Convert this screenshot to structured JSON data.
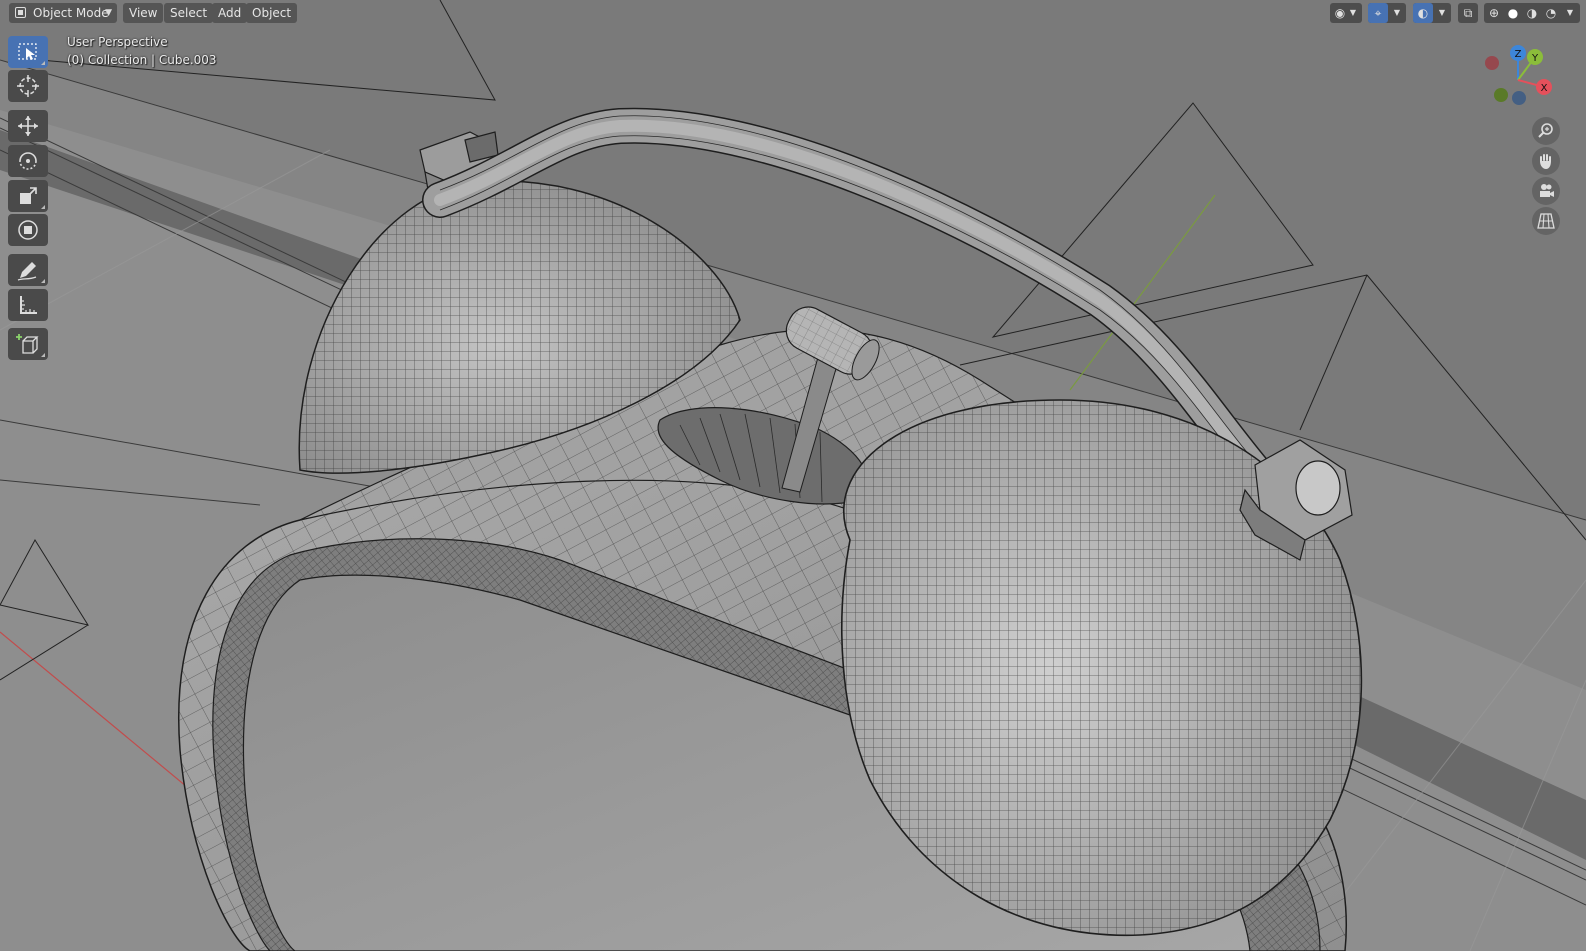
{
  "header": {
    "mode": "Object Mode",
    "menus": [
      "View",
      "Select",
      "Add",
      "Object"
    ]
  },
  "viewport_info": {
    "view_name": "User Perspective",
    "object_info": "(0) Collection | Cube.003"
  },
  "gizmo": {
    "axes": [
      "X",
      "Y",
      "Z"
    ],
    "colors": {
      "x": "#e5505b",
      "y": "#8bbd3a",
      "z": "#3d86d9"
    }
  },
  "toolbar": {
    "tools": [
      "select-box",
      "cursor",
      "move",
      "rotate",
      "scale",
      "transform",
      "annotate",
      "measure",
      "add-cube"
    ],
    "active": "select-box"
  },
  "viewport_shading": "solid",
  "colors": {
    "accent": "#4772b3",
    "background": "#7c7c7c",
    "x_axis_line": "#c24c4c",
    "y_axis_line": "#7a9a40"
  }
}
